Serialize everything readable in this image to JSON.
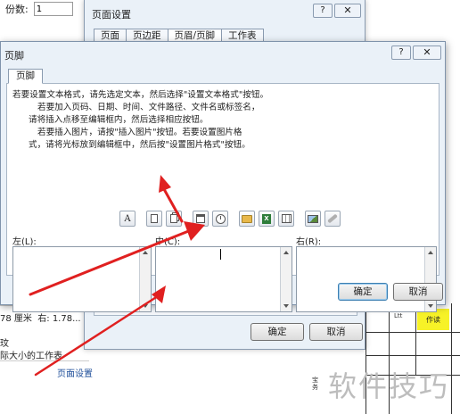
{
  "background": {
    "copies_label": "份数:",
    "copies_value": "1",
    "size_text": "78 厘米",
    "right_text": "右: 1.78...",
    "misc_char": "玟",
    "fit_text": "际大小的工作表",
    "page_setup_link": "页面设置",
    "grid_cell_text": "作读",
    "grid_tiny_1": "Ltt",
    "grid_tiny_2": "宝务",
    "watermark": "软件技巧",
    "yellow_color": "#f7f227"
  },
  "page_setup_dialog": {
    "title": "页面设置",
    "help_label": "?",
    "close_label": "✕",
    "tabs": [
      {
        "label": "页面",
        "active": false
      },
      {
        "label": "页边距",
        "active": false
      },
      {
        "label": "页眉/页脚",
        "active": true
      },
      {
        "label": "工作表",
        "active": false
      }
    ],
    "ok_label": "确定",
    "cancel_label": "取消"
  },
  "footer_dialog": {
    "title": "页脚",
    "help_label": "?",
    "close_label": "✕",
    "tab_label": "页脚",
    "instructions": [
      "若要设置文本格式，请先选定文本，然后选择\"设置文本格式\"按钮。",
      "若要加入页码、日期、时间、文件路径、文件名或标签名，",
      "请将插入点移至编辑框内，然后选择相应按钮。",
      "若要插入图片，请按\"插入图片\"按钮。若要设置图片格",
      "式，请将光标放到编辑框中，然后按\"设置图片格式\"按钮。"
    ],
    "toolbar": [
      {
        "icon": "format-text-icon",
        "glyph": "A"
      },
      {
        "icon": "page-number-icon"
      },
      {
        "icon": "page-count-icon"
      },
      {
        "icon": "date-icon",
        "glyph": "7"
      },
      {
        "icon": "time-icon"
      },
      {
        "icon": "file-path-icon"
      },
      {
        "icon": "file-name-icon"
      },
      {
        "icon": "sheet-name-icon"
      },
      {
        "icon": "insert-picture-icon"
      },
      {
        "icon": "format-picture-icon"
      }
    ],
    "sections": {
      "left_label": "左(L):",
      "center_label": "中(C):",
      "right_label": "右(R):"
    },
    "ok_label": "确定",
    "cancel_label": "取消",
    "arrow_color": "#e02020"
  }
}
